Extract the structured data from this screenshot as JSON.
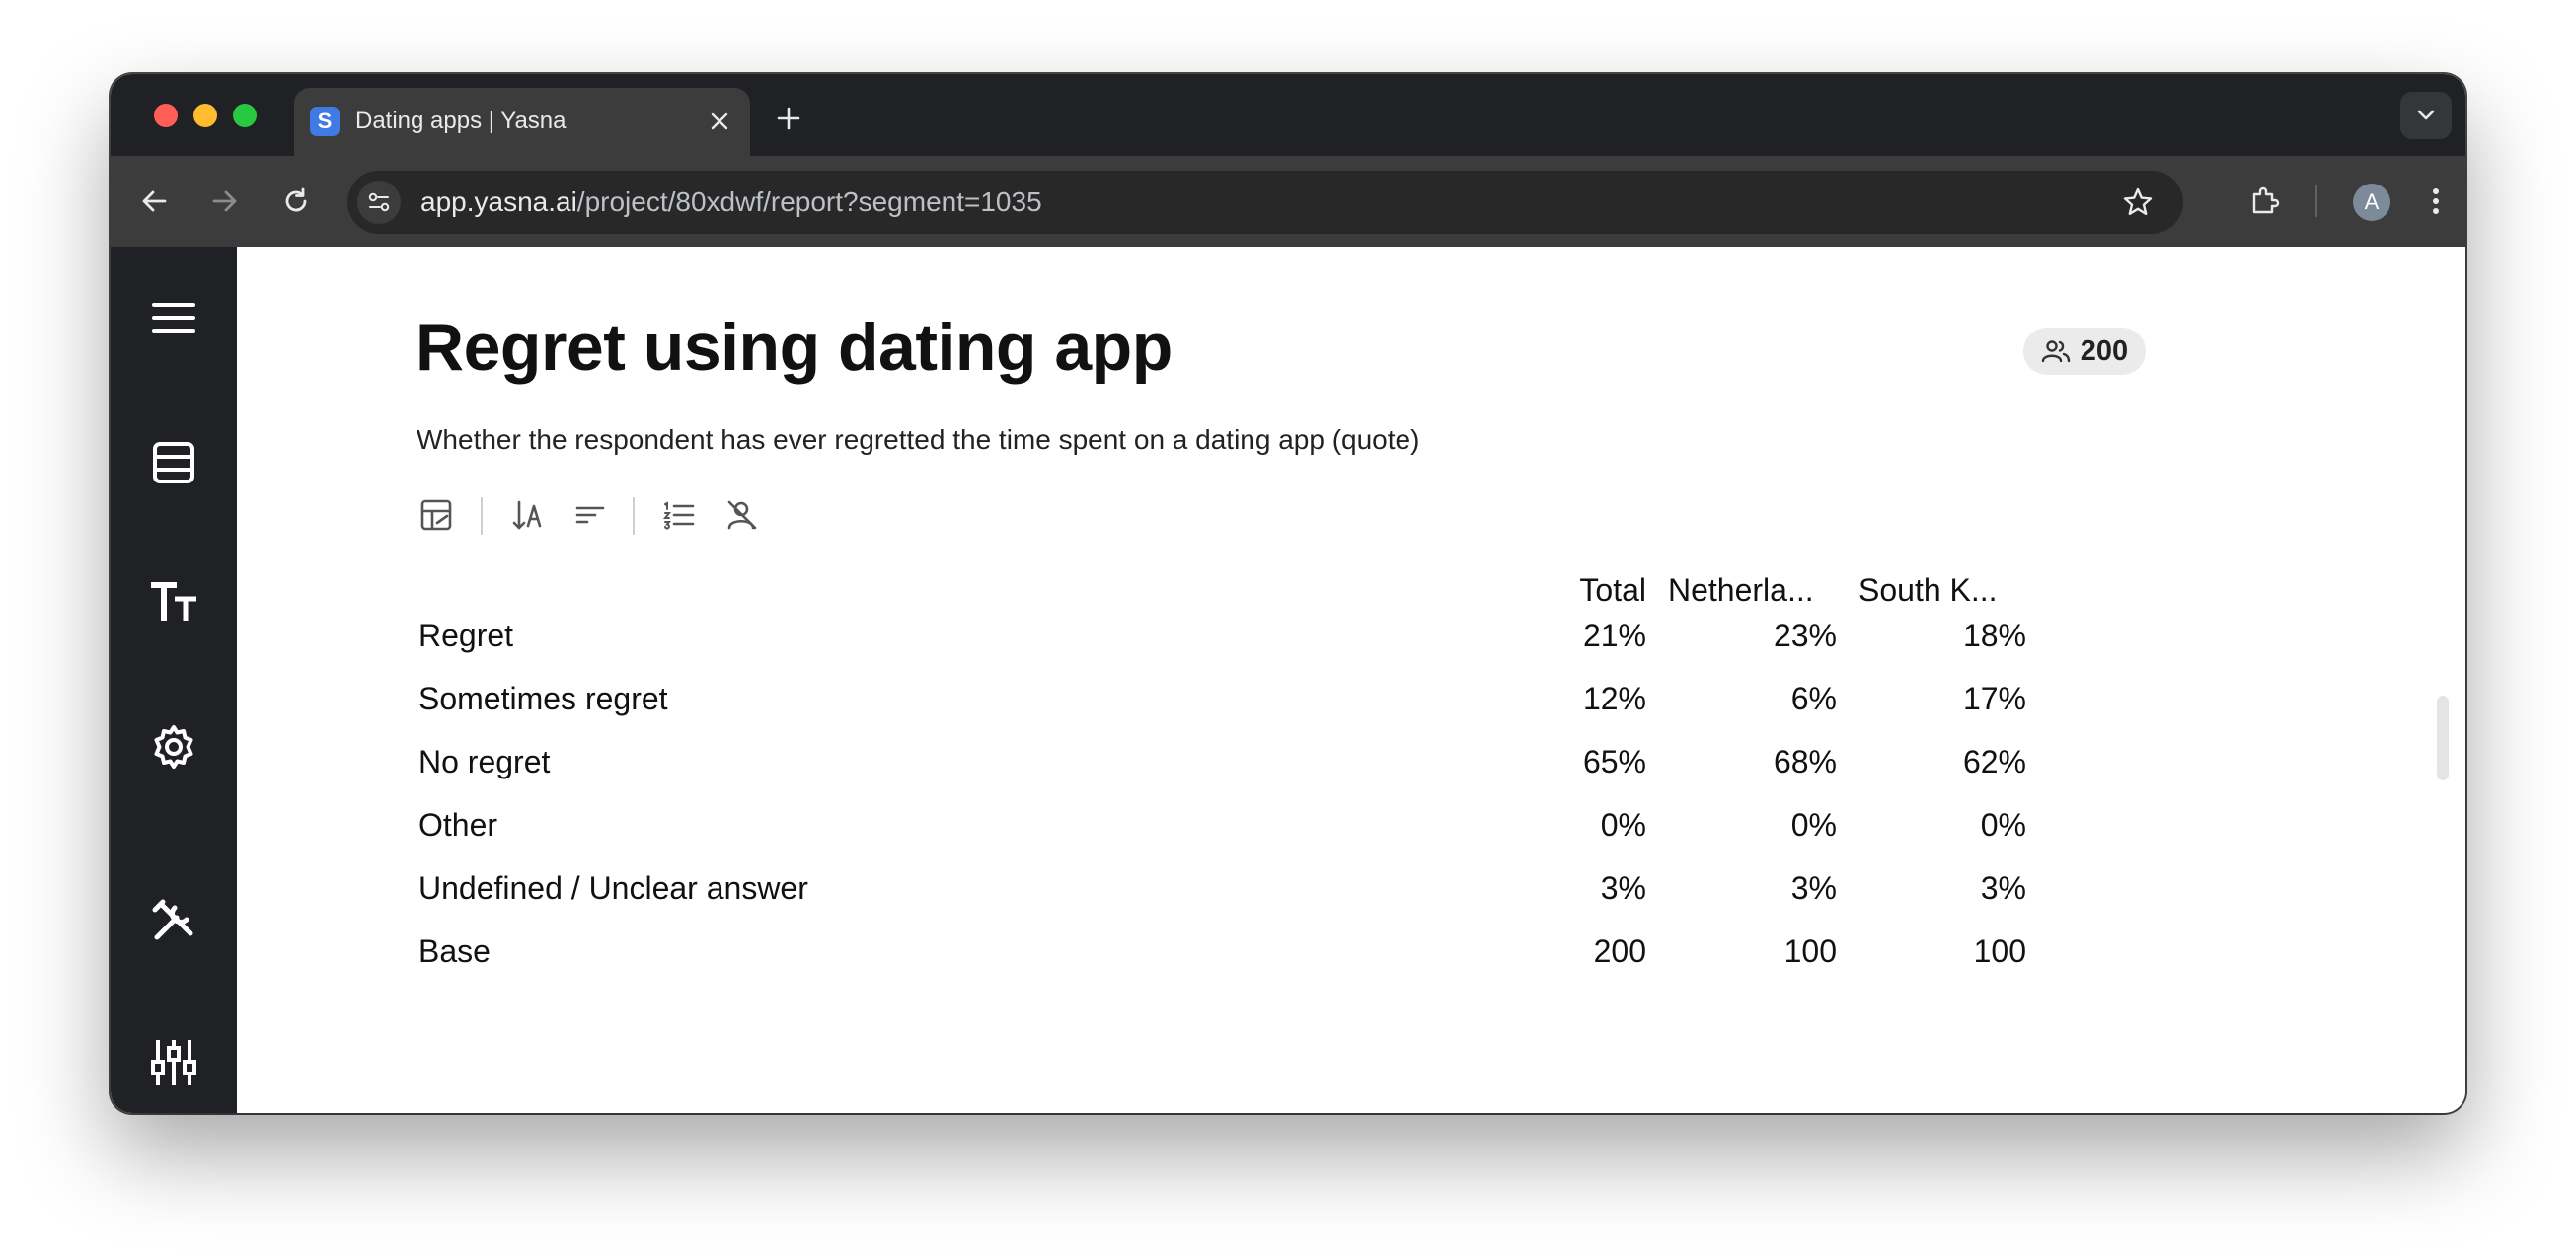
{
  "browser": {
    "tab": {
      "title": "Dating apps | Yasna",
      "favicon_letter": "S"
    },
    "url": {
      "host": "app.yasna.ai",
      "path": "/project/80xdwf/report?segment=1035"
    },
    "profile_initial": "A"
  },
  "sidebar": {
    "items": [
      {
        "icon": "hamburger-menu-icon"
      },
      {
        "icon": "table-icon"
      },
      {
        "icon": "text-size-icon"
      },
      {
        "icon": "gear-icon"
      },
      {
        "icon": "tools-icon"
      },
      {
        "icon": "sliders-icon"
      }
    ]
  },
  "report": {
    "title": "Regret using dating app",
    "respondents": "200",
    "description": "Whether the respondent has ever regretted the time spent on a dating app (quote)",
    "toolbar_icons": [
      "edit-chart-icon",
      "sort-alpha-icon",
      "sort-icon",
      "numbered-list-icon",
      "hide-person-icon"
    ]
  },
  "table": {
    "columns": [
      "Total",
      "Netherla...",
      "South K..."
    ],
    "rows": [
      {
        "label": "Regret",
        "values": [
          "21%",
          "23%",
          "18%"
        ]
      },
      {
        "label": "Sometimes regret",
        "values": [
          "12%",
          "6%",
          "17%"
        ]
      },
      {
        "label": "No regret",
        "values": [
          "65%",
          "68%",
          "62%"
        ]
      },
      {
        "label": "Other",
        "values": [
          "0%",
          "0%",
          "0%"
        ]
      },
      {
        "label": "Undefined / Unclear answer",
        "values": [
          "3%",
          "3%",
          "3%"
        ]
      },
      {
        "label": "Base",
        "values": [
          "200",
          "100",
          "100"
        ]
      }
    ]
  }
}
